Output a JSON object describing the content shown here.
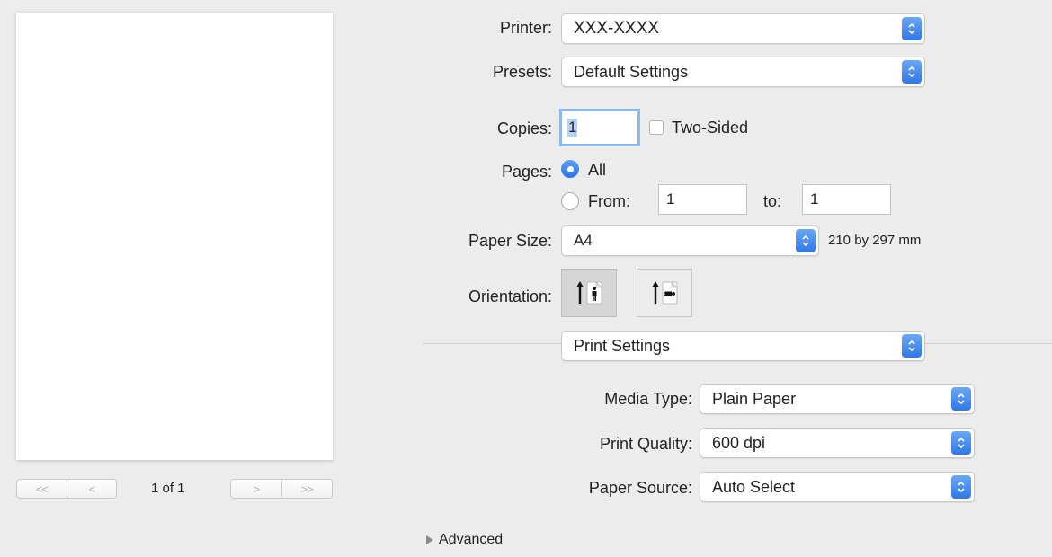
{
  "preview": {
    "page_count": "1 of 1",
    "nav_first": "<<",
    "nav_prev": "<",
    "nav_next": ">",
    "nav_last": ">>"
  },
  "printer": {
    "label": "Printer:",
    "value": "XXX-XXXX"
  },
  "presets": {
    "label": "Presets:",
    "value": "Default Settings"
  },
  "copies": {
    "label": "Copies:",
    "value": "1",
    "two_sided_label": "Two-Sided",
    "two_sided_checked": false
  },
  "pages": {
    "label": "Pages:",
    "all_label": "All",
    "from_label": "From:",
    "from_value": "1",
    "to_label": "to:",
    "to_value": "1",
    "selected": "All"
  },
  "paper_size": {
    "label": "Paper Size:",
    "value": "A4",
    "dimensions": "210 by 297 mm"
  },
  "orientation": {
    "label": "Orientation:",
    "selected": "portrait"
  },
  "section_popup": {
    "value": "Print Settings"
  },
  "media_type": {
    "label": "Media Type:",
    "value": "Plain Paper"
  },
  "print_quality": {
    "label": "Print Quality:",
    "value": "600 dpi"
  },
  "paper_source": {
    "label": "Paper Source:",
    "value": "Auto Select"
  },
  "advanced": {
    "label": "Advanced",
    "expanded": false
  },
  "colors": {
    "accent": "#2f78e6",
    "background": "#ececec"
  }
}
